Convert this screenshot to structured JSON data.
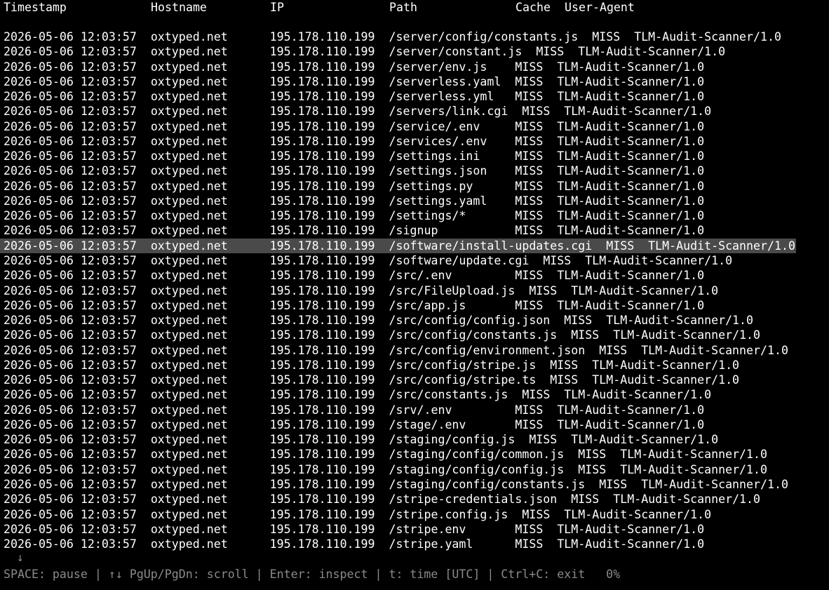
{
  "header": {
    "timestamp": "Timestamp",
    "hostname": "Hostname",
    "ip": "IP",
    "path": "Path",
    "cache": "Cache",
    "user_agent": "User-Agent"
  },
  "rows": [
    {
      "timestamp": "2026-05-06 12:03:57",
      "hostname": "oxtyped.net",
      "ip": "195.178.110.199",
      "path": "/server/config/constants.js",
      "cache": "MISS",
      "user_agent": "TLM-Audit-Scanner/1.0"
    },
    {
      "timestamp": "2026-05-06 12:03:57",
      "hostname": "oxtyped.net",
      "ip": "195.178.110.199",
      "path": "/server/constant.js",
      "cache": "MISS",
      "user_agent": "TLM-Audit-Scanner/1.0"
    },
    {
      "timestamp": "2026-05-06 12:03:57",
      "hostname": "oxtyped.net",
      "ip": "195.178.110.199",
      "path": "/server/env.js",
      "cache": "MISS",
      "user_agent": "TLM-Audit-Scanner/1.0"
    },
    {
      "timestamp": "2026-05-06 12:03:57",
      "hostname": "oxtyped.net",
      "ip": "195.178.110.199",
      "path": "/serverless.yaml",
      "cache": "MISS",
      "user_agent": "TLM-Audit-Scanner/1.0"
    },
    {
      "timestamp": "2026-05-06 12:03:57",
      "hostname": "oxtyped.net",
      "ip": "195.178.110.199",
      "path": "/serverless.yml",
      "cache": "MISS",
      "user_agent": "TLM-Audit-Scanner/1.0"
    },
    {
      "timestamp": "2026-05-06 12:03:57",
      "hostname": "oxtyped.net",
      "ip": "195.178.110.199",
      "path": "/servers/link.cgi",
      "cache": "MISS",
      "user_agent": "TLM-Audit-Scanner/1.0"
    },
    {
      "timestamp": "2026-05-06 12:03:57",
      "hostname": "oxtyped.net",
      "ip": "195.178.110.199",
      "path": "/service/.env",
      "cache": "MISS",
      "user_agent": "TLM-Audit-Scanner/1.0"
    },
    {
      "timestamp": "2026-05-06 12:03:57",
      "hostname": "oxtyped.net",
      "ip": "195.178.110.199",
      "path": "/services/.env",
      "cache": "MISS",
      "user_agent": "TLM-Audit-Scanner/1.0"
    },
    {
      "timestamp": "2026-05-06 12:03:57",
      "hostname": "oxtyped.net",
      "ip": "195.178.110.199",
      "path": "/settings.ini",
      "cache": "MISS",
      "user_agent": "TLM-Audit-Scanner/1.0"
    },
    {
      "timestamp": "2026-05-06 12:03:57",
      "hostname": "oxtyped.net",
      "ip": "195.178.110.199",
      "path": "/settings.json",
      "cache": "MISS",
      "user_agent": "TLM-Audit-Scanner/1.0"
    },
    {
      "timestamp": "2026-05-06 12:03:57",
      "hostname": "oxtyped.net",
      "ip": "195.178.110.199",
      "path": "/settings.py",
      "cache": "MISS",
      "user_agent": "TLM-Audit-Scanner/1.0"
    },
    {
      "timestamp": "2026-05-06 12:03:57",
      "hostname": "oxtyped.net",
      "ip": "195.178.110.199",
      "path": "/settings.yaml",
      "cache": "MISS",
      "user_agent": "TLM-Audit-Scanner/1.0"
    },
    {
      "timestamp": "2026-05-06 12:03:57",
      "hostname": "oxtyped.net",
      "ip": "195.178.110.199",
      "path": "/settings/*",
      "cache": "MISS",
      "user_agent": "TLM-Audit-Scanner/1.0"
    },
    {
      "timestamp": "2026-05-06 12:03:57",
      "hostname": "oxtyped.net",
      "ip": "195.178.110.199",
      "path": "/signup",
      "cache": "MISS",
      "user_agent": "TLM-Audit-Scanner/1.0"
    },
    {
      "timestamp": "2026-05-06 12:03:57",
      "hostname": "oxtyped.net",
      "ip": "195.178.110.199",
      "path": "/software/install-updates.cgi",
      "cache": "MISS",
      "user_agent": "TLM-Audit-Scanner/1.0",
      "selected": true
    },
    {
      "timestamp": "2026-05-06 12:03:57",
      "hostname": "oxtyped.net",
      "ip": "195.178.110.199",
      "path": "/software/update.cgi",
      "cache": "MISS",
      "user_agent": "TLM-Audit-Scanner/1.0"
    },
    {
      "timestamp": "2026-05-06 12:03:57",
      "hostname": "oxtyped.net",
      "ip": "195.178.110.199",
      "path": "/src/.env",
      "cache": "MISS",
      "user_agent": "TLM-Audit-Scanner/1.0"
    },
    {
      "timestamp": "2026-05-06 12:03:57",
      "hostname": "oxtyped.net",
      "ip": "195.178.110.199",
      "path": "/src/FileUpload.js",
      "cache": "MISS",
      "user_agent": "TLM-Audit-Scanner/1.0"
    },
    {
      "timestamp": "2026-05-06 12:03:57",
      "hostname": "oxtyped.net",
      "ip": "195.178.110.199",
      "path": "/src/app.js",
      "cache": "MISS",
      "user_agent": "TLM-Audit-Scanner/1.0"
    },
    {
      "timestamp": "2026-05-06 12:03:57",
      "hostname": "oxtyped.net",
      "ip": "195.178.110.199",
      "path": "/src/config/config.json",
      "cache": "MISS",
      "user_agent": "TLM-Audit-Scanner/1.0"
    },
    {
      "timestamp": "2026-05-06 12:03:57",
      "hostname": "oxtyped.net",
      "ip": "195.178.110.199",
      "path": "/src/config/constants.js",
      "cache": "MISS",
      "user_agent": "TLM-Audit-Scanner/1.0"
    },
    {
      "timestamp": "2026-05-06 12:03:57",
      "hostname": "oxtyped.net",
      "ip": "195.178.110.199",
      "path": "/src/config/environment.json",
      "cache": "MISS",
      "user_agent": "TLM-Audit-Scanner/1.0"
    },
    {
      "timestamp": "2026-05-06 12:03:57",
      "hostname": "oxtyped.net",
      "ip": "195.178.110.199",
      "path": "/src/config/stripe.js",
      "cache": "MISS",
      "user_agent": "TLM-Audit-Scanner/1.0"
    },
    {
      "timestamp": "2026-05-06 12:03:57",
      "hostname": "oxtyped.net",
      "ip": "195.178.110.199",
      "path": "/src/config/stripe.ts",
      "cache": "MISS",
      "user_agent": "TLM-Audit-Scanner/1.0"
    },
    {
      "timestamp": "2026-05-06 12:03:57",
      "hostname": "oxtyped.net",
      "ip": "195.178.110.199",
      "path": "/src/constants.js",
      "cache": "MISS",
      "user_agent": "TLM-Audit-Scanner/1.0"
    },
    {
      "timestamp": "2026-05-06 12:03:57",
      "hostname": "oxtyped.net",
      "ip": "195.178.110.199",
      "path": "/srv/.env",
      "cache": "MISS",
      "user_agent": "TLM-Audit-Scanner/1.0"
    },
    {
      "timestamp": "2026-05-06 12:03:57",
      "hostname": "oxtyped.net",
      "ip": "195.178.110.199",
      "path": "/stage/.env",
      "cache": "MISS",
      "user_agent": "TLM-Audit-Scanner/1.0"
    },
    {
      "timestamp": "2026-05-06 12:03:57",
      "hostname": "oxtyped.net",
      "ip": "195.178.110.199",
      "path": "/staging/config.js",
      "cache": "MISS",
      "user_agent": "TLM-Audit-Scanner/1.0"
    },
    {
      "timestamp": "2026-05-06 12:03:57",
      "hostname": "oxtyped.net",
      "ip": "195.178.110.199",
      "path": "/staging/config/common.js",
      "cache": "MISS",
      "user_agent": "TLM-Audit-Scanner/1.0"
    },
    {
      "timestamp": "2026-05-06 12:03:57",
      "hostname": "oxtyped.net",
      "ip": "195.178.110.199",
      "path": "/staging/config/config.js",
      "cache": "MISS",
      "user_agent": "TLM-Audit-Scanner/1.0"
    },
    {
      "timestamp": "2026-05-06 12:03:57",
      "hostname": "oxtyped.net",
      "ip": "195.178.110.199",
      "path": "/staging/config/constants.js",
      "cache": "MISS",
      "user_agent": "TLM-Audit-Scanner/1.0"
    },
    {
      "timestamp": "2026-05-06 12:03:57",
      "hostname": "oxtyped.net",
      "ip": "195.178.110.199",
      "path": "/stripe-credentials.json",
      "cache": "MISS",
      "user_agent": "TLM-Audit-Scanner/1.0"
    },
    {
      "timestamp": "2026-05-06 12:03:57",
      "hostname": "oxtyped.net",
      "ip": "195.178.110.199",
      "path": "/stripe.config.js",
      "cache": "MISS",
      "user_agent": "TLM-Audit-Scanner/1.0"
    },
    {
      "timestamp": "2026-05-06 12:03:57",
      "hostname": "oxtyped.net",
      "ip": "195.178.110.199",
      "path": "/stripe.env",
      "cache": "MISS",
      "user_agent": "TLM-Audit-Scanner/1.0"
    },
    {
      "timestamp": "2026-05-06 12:03:57",
      "hostname": "oxtyped.net",
      "ip": "195.178.110.199",
      "path": "/stripe.yaml",
      "cache": "MISS",
      "user_agent": "TLM-Audit-Scanner/1.0"
    }
  ],
  "scroll_indicator": "↓",
  "status_bar": "SPACE: pause | ↑↓ PgUp/PgDn: scroll | Enter: inspect | t: time [UTC] | Ctrl+C: exit   0%",
  "colors": {
    "background": "#000000",
    "text": "#ffffff",
    "selected_row": "#4a4a4a",
    "status_text": "#8a8a8a"
  }
}
